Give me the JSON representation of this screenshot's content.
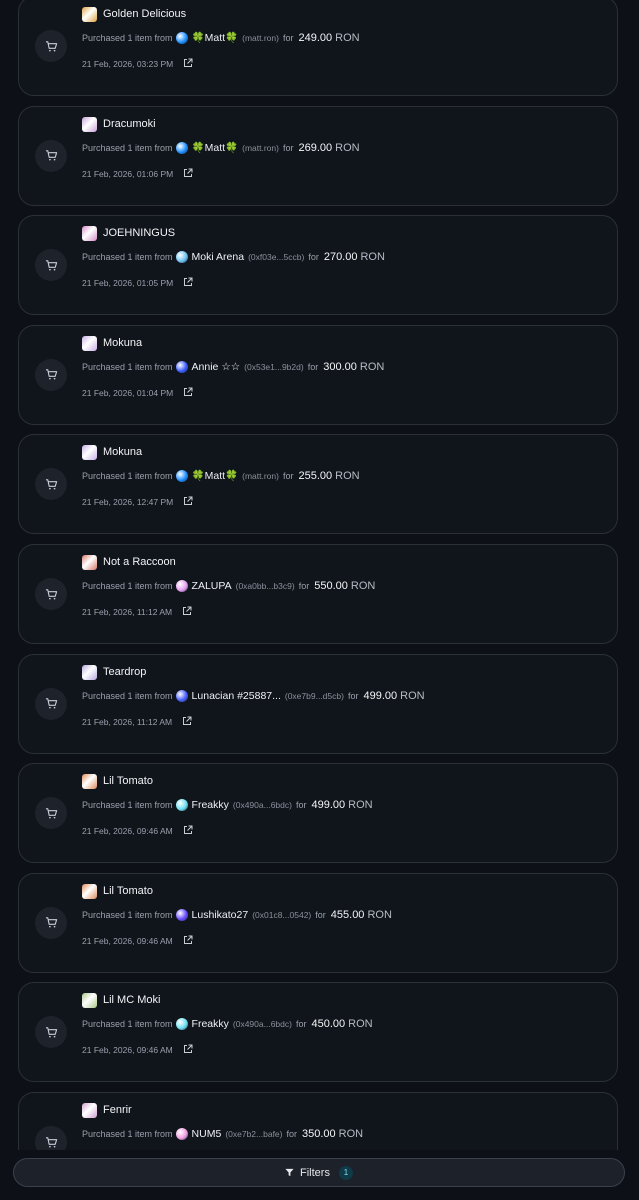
{
  "colors": {
    "background": "#0d1117",
    "card": "#10141b",
    "border": "#2a2f38",
    "accent": "#8fd9ef"
  },
  "sales": [
    {
      "nft_name": "Golden Delicious",
      "thumb_color": "#e0a040",
      "prefix": "Purchased 1 item from",
      "buyer": "🍀Matt🍀",
      "buyer_color": "#1e90ff",
      "address": "(matt.ron)",
      "for_text": "for",
      "amount": "249.00",
      "currency": "RON",
      "timestamp": "21 Feb, 2026, 03:23 PM"
    },
    {
      "nft_name": "Dracumoki",
      "thumb_color": "#c9a0d8",
      "prefix": "Purchased 1 item from",
      "buyer": "🍀Matt🍀",
      "buyer_color": "#1e90ff",
      "address": "(matt.ron)",
      "for_text": "for",
      "amount": "269.00",
      "currency": "RON",
      "timestamp": "21 Feb, 2026, 01:06 PM"
    },
    {
      "nft_name": "JOEHNINGUS",
      "thumb_color": "#d88ac9",
      "prefix": "Purchased 1 item from",
      "buyer": "Moki Arena",
      "buyer_color": "#6ec3f0",
      "address": "(0xf03e...5ccb)",
      "for_text": "for",
      "amount": "270.00",
      "currency": "RON",
      "timestamp": "21 Feb, 2026, 01:05 PM"
    },
    {
      "nft_name": "Mokuna",
      "thumb_color": "#c8b0e8",
      "prefix": "Purchased 1 item from",
      "buyer": "Annie ☆☆",
      "buyer_color": "#3a5cff",
      "address": "(0x53e1...9b2d)",
      "for_text": "for",
      "amount": "300.00",
      "currency": "RON",
      "timestamp": "21 Feb, 2026, 01:04 PM"
    },
    {
      "nft_name": "Mokuna",
      "thumb_color": "#c8b0e8",
      "prefix": "Purchased 1 item from",
      "buyer": "🍀Matt🍀",
      "buyer_color": "#1e90ff",
      "address": "(matt.ron)",
      "for_text": "for",
      "amount": "255.00",
      "currency": "RON",
      "timestamp": "21 Feb, 2026, 12:47 PM"
    },
    {
      "nft_name": "Not a Raccoon",
      "thumb_color": "#d87a6a",
      "prefix": "Purchased 1 item from",
      "buyer": "ZALUPA",
      "buyer_color": "#e8a0f0",
      "address": "(0xa0bb...b3c9)",
      "for_text": "for",
      "amount": "550.00",
      "currency": "RON",
      "timestamp": "21 Feb, 2026, 11:12 AM"
    },
    {
      "nft_name": "Teardrop",
      "thumb_color": "#b8a8e0",
      "prefix": "Purchased 1 item from",
      "buyer": "Lunacian #25887...",
      "buyer_color": "#4a60ff",
      "address": "(0xe7b9...d5cb)",
      "for_text": "for",
      "amount": "499.00",
      "currency": "RON",
      "timestamp": "21 Feb, 2026, 11:12 AM"
    },
    {
      "nft_name": "Lil Tomato",
      "thumb_color": "#e08a5a",
      "prefix": "Purchased 1 item from",
      "buyer": "Freakky",
      "buyer_color": "#6ee0f0",
      "address": "(0x490a...6bdc)",
      "for_text": "for",
      "amount": "499.00",
      "currency": "RON",
      "timestamp": "21 Feb, 2026, 09:46 AM"
    },
    {
      "nft_name": "Lil Tomato",
      "thumb_color": "#e08a5a",
      "prefix": "Purchased 1 item from",
      "buyer": "Lushikato27",
      "buyer_color": "#6a4cff",
      "address": "(0x01c8...0542)",
      "for_text": "for",
      "amount": "455.00",
      "currency": "RON",
      "timestamp": "21 Feb, 2026, 09:46 AM"
    },
    {
      "nft_name": "Lil MC Moki",
      "thumb_color": "#a8c888",
      "prefix": "Purchased 1 item from",
      "buyer": "Freakky",
      "buyer_color": "#6ee0f0",
      "address": "(0x490a...6bdc)",
      "for_text": "for",
      "amount": "450.00",
      "currency": "RON",
      "timestamp": "21 Feb, 2026, 09:46 AM"
    },
    {
      "nft_name": "Fenrir",
      "thumb_color": "#d0a0d0",
      "prefix": "Purchased 1 item from",
      "buyer": "NUM5",
      "buyer_color": "#f0a0e0",
      "address": "(0xe7b2...bafe)",
      "for_text": "for",
      "amount": "350.00",
      "currency": "RON",
      "timestamp": ""
    }
  ],
  "filter_bar": {
    "label": "Filters",
    "count": "1",
    "icon": "funnel-icon"
  }
}
